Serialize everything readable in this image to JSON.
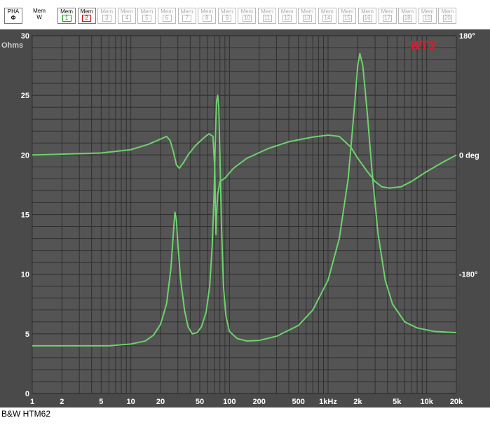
{
  "toolbar": {
    "pha": {
      "label": "PHA",
      "sub": "Φ"
    },
    "memw": {
      "label": "Mem",
      "sub": "W"
    },
    "mems": [
      {
        "label": "Mem",
        "num": "1"
      },
      {
        "label": "Mem",
        "num": "2"
      },
      {
        "label": "Mem",
        "num": "3"
      },
      {
        "label": "Mem",
        "num": "4"
      },
      {
        "label": "Mem",
        "num": "5"
      },
      {
        "label": "Mem",
        "num": "6"
      },
      {
        "label": "Mem",
        "num": "7"
      },
      {
        "label": "Mem",
        "num": "8"
      },
      {
        "label": "Mem",
        "num": "9"
      },
      {
        "label": "Mem",
        "num": "10"
      },
      {
        "label": "Mem",
        "num": "11"
      },
      {
        "label": "Mem",
        "num": "12"
      },
      {
        "label": "Mem",
        "num": "13"
      },
      {
        "label": "Mem",
        "num": "14"
      },
      {
        "label": "Mem",
        "num": "15"
      },
      {
        "label": "Mem",
        "num": "16"
      },
      {
        "label": "Mem",
        "num": "17"
      },
      {
        "label": "Mem",
        "num": "18"
      },
      {
        "label": "Mem",
        "num": "19"
      },
      {
        "label": "Mem",
        "num": "20"
      }
    ]
  },
  "caption": "B&W HTM62",
  "colors": {
    "plot_bg": "#545454",
    "grid": "#2f2f2f",
    "curve": "#6cd26c",
    "logo": "#e8162a"
  },
  "chart_data": {
    "type": "line",
    "logo": "WT3",
    "y_unit_label": "Ohms",
    "x_scale": "log",
    "xlim": [
      1,
      20000
    ],
    "ylim": [
      0,
      30
    ],
    "grid": true,
    "x_ticks": [
      {
        "value": 1,
        "label": "1"
      },
      {
        "value": 2,
        "label": "2"
      },
      {
        "value": 5,
        "label": "5"
      },
      {
        "value": 10,
        "label": "10"
      },
      {
        "value": 20,
        "label": "20"
      },
      {
        "value": 50,
        "label": "50"
      },
      {
        "value": 100,
        "label": "100"
      },
      {
        "value": 200,
        "label": "200"
      },
      {
        "value": 500,
        "label": "500"
      },
      {
        "value": 1000,
        "label": "1kHz"
      },
      {
        "value": 2000,
        "label": "2k"
      },
      {
        "value": 5000,
        "label": "5k"
      },
      {
        "value": 10000,
        "label": "10k"
      },
      {
        "value": 20000,
        "label": "20k"
      }
    ],
    "y_ticks": [
      {
        "value": 0,
        "label": "0"
      },
      {
        "value": 5,
        "label": "5"
      },
      {
        "value": 10,
        "label": "10"
      },
      {
        "value": 15,
        "label": "15"
      },
      {
        "value": 20,
        "label": "20"
      },
      {
        "value": 25,
        "label": "25"
      },
      {
        "value": 30,
        "label": "30"
      }
    ],
    "phase_axis": {
      "range_deg": [
        -360,
        180
      ],
      "ticks": [
        {
          "value": 180,
          "label": "180°"
        },
        {
          "value": 0,
          "label": "0 deg"
        },
        {
          "value": -180,
          "label": "-180°"
        }
      ]
    },
    "series": [
      {
        "axis": "impedance",
        "points": [
          [
            1,
            4.0
          ],
          [
            3,
            4.0
          ],
          [
            6,
            4.0
          ],
          [
            10,
            4.15
          ],
          [
            14,
            4.4
          ],
          [
            17,
            4.9
          ],
          [
            20,
            5.8
          ],
          [
            23,
            7.5
          ],
          [
            25.5,
            10.5
          ],
          [
            27,
            13.5
          ],
          [
            28,
            15.2
          ],
          [
            29,
            14.5
          ],
          [
            30,
            12.5
          ],
          [
            32,
            9.5
          ],
          [
            35,
            7.0
          ],
          [
            38,
            5.6
          ],
          [
            42,
            5.0
          ],
          [
            47,
            5.1
          ],
          [
            52,
            5.6
          ],
          [
            58,
            6.8
          ],
          [
            63,
            9.0
          ],
          [
            67,
            12.5
          ],
          [
            70,
            17.0
          ],
          [
            72,
            21.5
          ],
          [
            74,
            24.5
          ],
          [
            76,
            25.0
          ],
          [
            78,
            24.0
          ],
          [
            80,
            20.0
          ],
          [
            83,
            14.0
          ],
          [
            87,
            9.0
          ],
          [
            92,
            6.5
          ],
          [
            100,
            5.2
          ],
          [
            120,
            4.6
          ],
          [
            150,
            4.4
          ],
          [
            200,
            4.45
          ],
          [
            300,
            4.8
          ],
          [
            500,
            5.7
          ],
          [
            700,
            7.0
          ],
          [
            1000,
            9.5
          ],
          [
            1300,
            13.0
          ],
          [
            1600,
            18.0
          ],
          [
            1850,
            24.0
          ],
          [
            2000,
            27.5
          ],
          [
            2100,
            28.5
          ],
          [
            2250,
            27.5
          ],
          [
            2500,
            23.5
          ],
          [
            2800,
            18.5
          ],
          [
            3200,
            13.5
          ],
          [
            3800,
            9.5
          ],
          [
            4500,
            7.5
          ],
          [
            6000,
            6.0
          ],
          [
            8000,
            5.5
          ],
          [
            12000,
            5.2
          ],
          [
            20000,
            5.1
          ]
        ]
      },
      {
        "axis": "phase",
        "points": [
          [
            1,
            0
          ],
          [
            5,
            3
          ],
          [
            10,
            8
          ],
          [
            15,
            16
          ],
          [
            20,
            24
          ],
          [
            23,
            28
          ],
          [
            25,
            22
          ],
          [
            27,
            5
          ],
          [
            29,
            -15
          ],
          [
            31,
            -20
          ],
          [
            34,
            -12
          ],
          [
            38,
            0
          ],
          [
            45,
            14
          ],
          [
            55,
            26
          ],
          [
            62,
            32
          ],
          [
            68,
            28
          ],
          [
            71,
            -20
          ],
          [
            72,
            -80
          ],
          [
            73,
            -120
          ],
          [
            74,
            -90
          ],
          [
            76,
            -60
          ],
          [
            80,
            -40
          ],
          [
            90,
            -35
          ],
          [
            110,
            -20
          ],
          [
            150,
            -5
          ],
          [
            250,
            10
          ],
          [
            400,
            20
          ],
          [
            700,
            27
          ],
          [
            1000,
            30
          ],
          [
            1300,
            28
          ],
          [
            1700,
            12
          ],
          [
            2000,
            -5
          ],
          [
            2500,
            -25
          ],
          [
            3000,
            -40
          ],
          [
            3500,
            -48
          ],
          [
            4200,
            -50
          ],
          [
            5500,
            -48
          ],
          [
            7000,
            -40
          ],
          [
            10000,
            -25
          ],
          [
            15000,
            -10
          ],
          [
            20000,
            0
          ]
        ]
      }
    ]
  }
}
